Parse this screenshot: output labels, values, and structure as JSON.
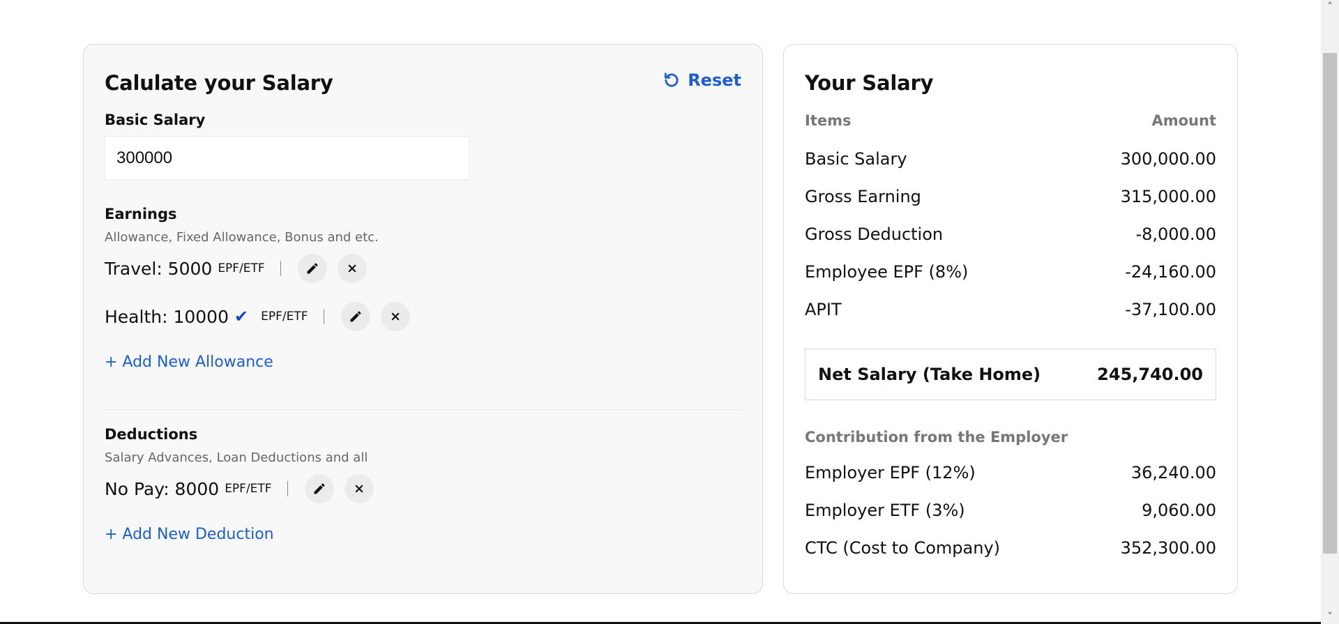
{
  "calculator": {
    "title": "Calulate your Salary",
    "reset_label": "Reset",
    "basic_salary_label": "Basic Salary",
    "basic_salary_value": "300000",
    "earnings": {
      "label": "Earnings",
      "description": "Allowance, Fixed Allowance, Bonus and etc.",
      "items": [
        {
          "name": "Travel: 5000",
          "checked": false,
          "tag": "EPF/ETF"
        },
        {
          "name": "Health: 10000",
          "checked": true,
          "check_mark": "✔",
          "tag": "EPF/ETF"
        }
      ],
      "add_label": "+ Add New Allowance"
    },
    "deductions": {
      "label": "Deductions",
      "description": "Salary Advances, Loan Deductions and all",
      "items": [
        {
          "name": "No Pay: 8000",
          "tag": "EPF/ETF"
        }
      ],
      "add_label": "+ Add New Deduction"
    }
  },
  "summary": {
    "title": "Your Salary",
    "col_items": "Items",
    "col_amount": "Amount",
    "rows": [
      {
        "label": "Basic Salary",
        "amount": "300,000.00"
      },
      {
        "label": "Gross Earning",
        "amount": "315,000.00"
      },
      {
        "label": "Gross Deduction",
        "amount": "-8,000.00"
      },
      {
        "label": "Employee EPF (8%)",
        "amount": "-24,160.00"
      },
      {
        "label": "APIT",
        "amount": "-37,100.00"
      }
    ],
    "net": {
      "label": "Net Salary (Take Home)",
      "amount": "245,740.00"
    },
    "contribution_title": "Contribution from the Employer",
    "contrib_rows": [
      {
        "label": "Employer EPF (12%)",
        "amount": "36,240.00"
      },
      {
        "label": "Employer ETF (3%)",
        "amount": "9,060.00"
      },
      {
        "label": "CTC (Cost to Company)",
        "amount": "352,300.00"
      }
    ]
  },
  "colors": {
    "accent": "#1b5ed1",
    "check": "#1b43d1",
    "muted": "#777777"
  },
  "icons": [
    "reset-icon",
    "pencil-icon",
    "close-icon"
  ]
}
